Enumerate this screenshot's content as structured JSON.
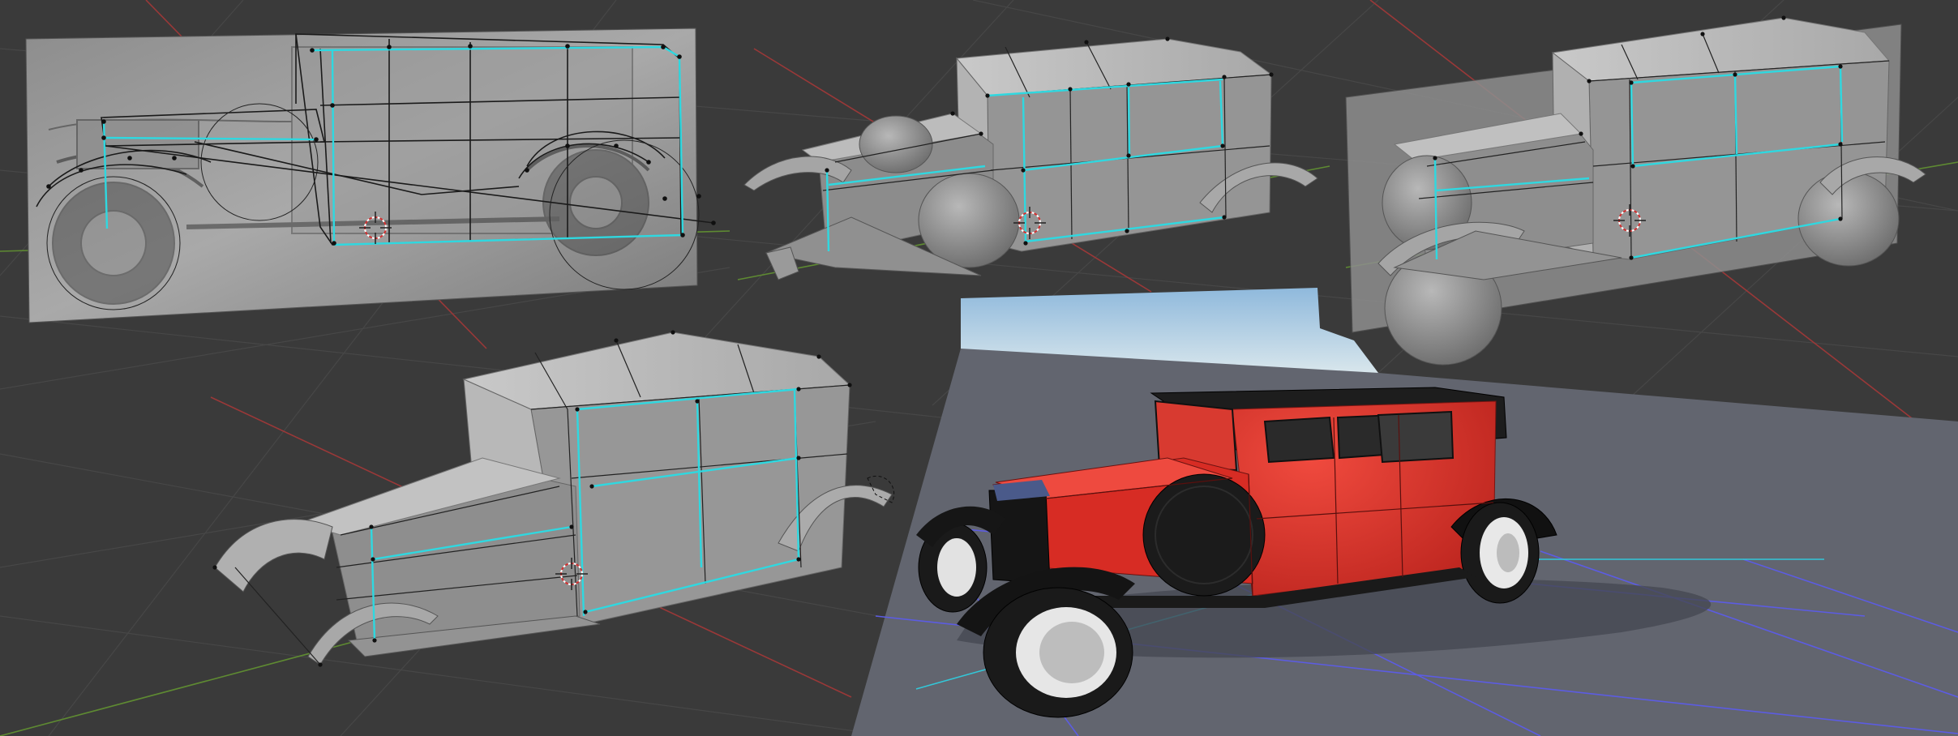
{
  "app": {
    "view": "3d-viewport-collage"
  },
  "colors": {
    "viewport_bg": "#3a3a3a",
    "grid_line": "#4a4a4a",
    "axis_x": "#b04040",
    "axis_y": "#6a9a3a",
    "mesh_gray": "#8a8a8a",
    "mesh_light": "#b5b5b5",
    "selected_edge": "#2fd8e0",
    "wire_dark": "#111111",
    "render_floor": "#5f6270",
    "render_grid": "#5a5ae0",
    "render_grid_cyan": "#30c0d0",
    "sky_top": "#9cc2e0",
    "sky_bottom": "#d5e6ee",
    "car_red": "#d8302a",
    "car_black": "#1e1e1e",
    "wheel_white": "#e8e8e8"
  },
  "panels": [
    {
      "name": "reference-image-blockout",
      "icon": "3d-cursor-icon"
    },
    {
      "name": "early-body-blockout",
      "icon": "3d-cursor-icon"
    },
    {
      "name": "blockout-with-reference",
      "icon": "3d-cursor-icon"
    },
    {
      "name": "refined-body-blockout",
      "icon": "3d-cursor-icon"
    },
    {
      "name": "viewport-shaded-preview",
      "icon": ""
    }
  ]
}
